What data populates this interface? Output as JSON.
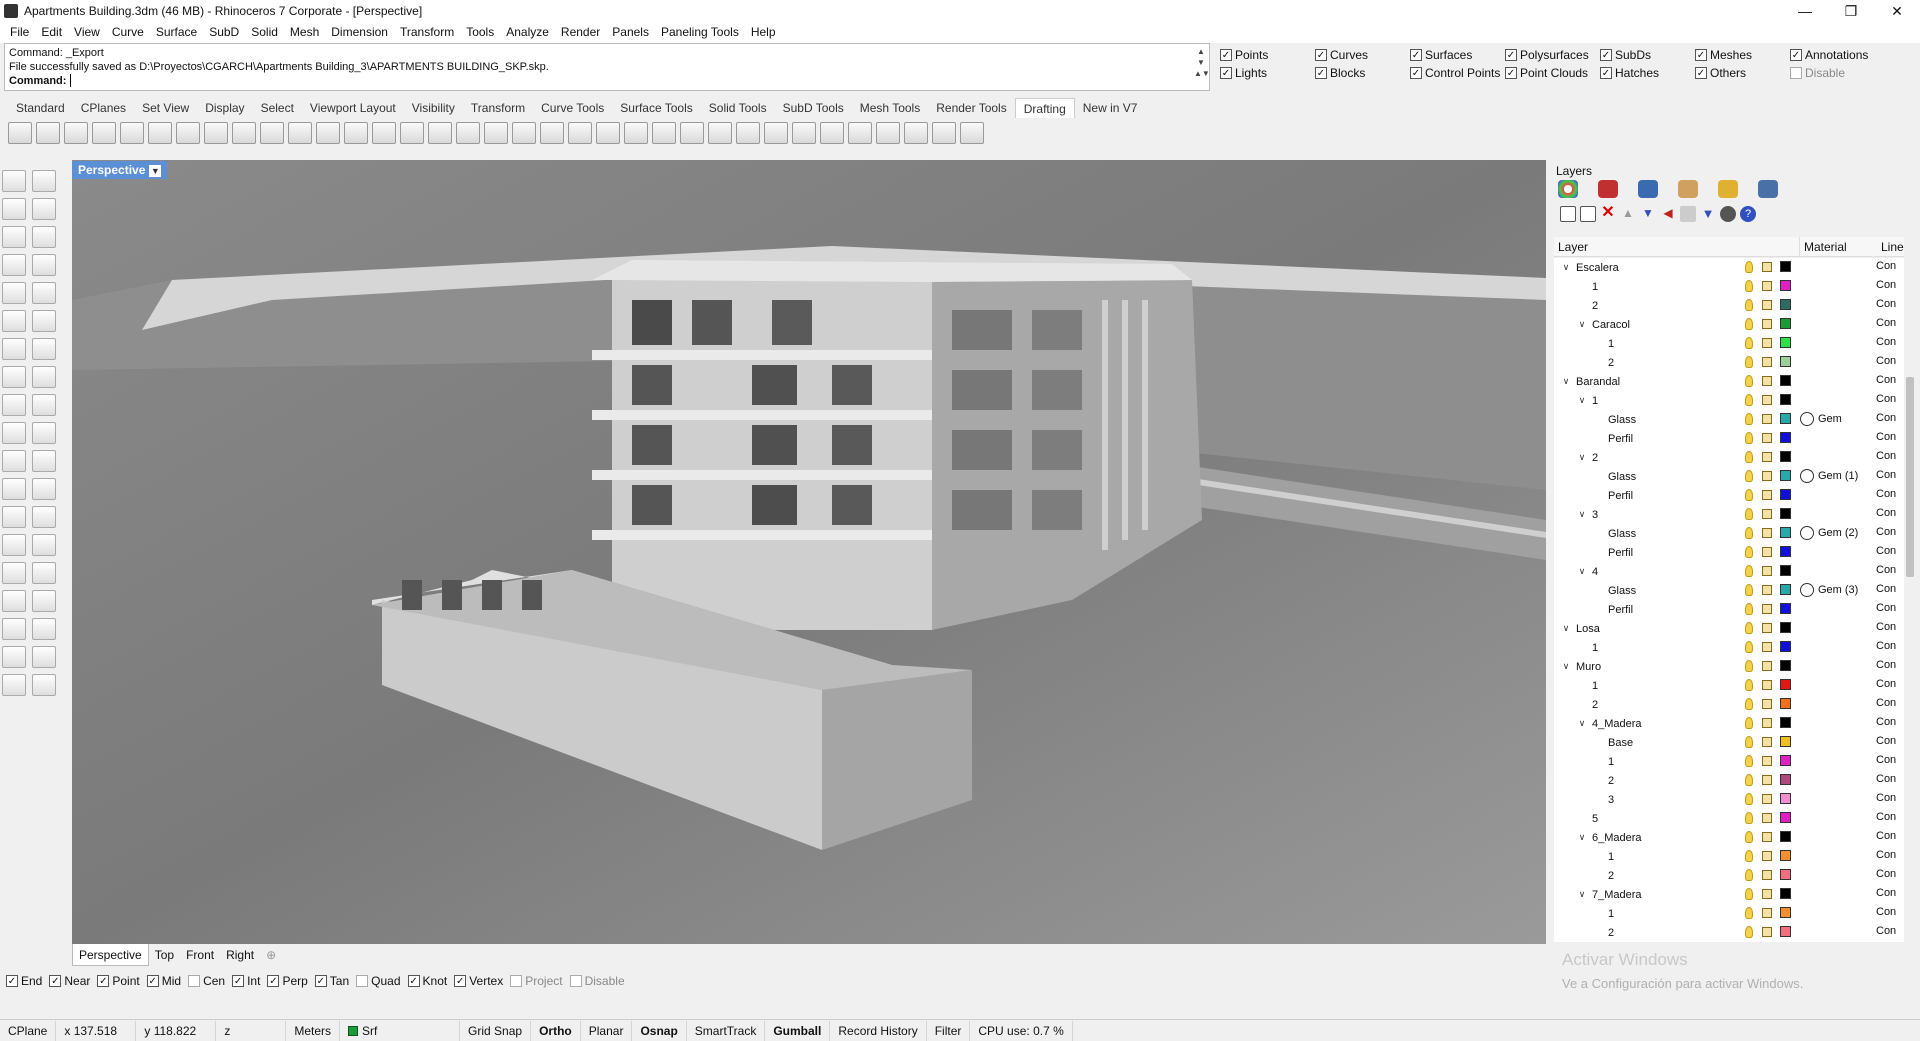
{
  "window": {
    "title": "Apartments Building.3dm (46 MB) - Rhinoceros 7 Corporate - [Perspective]"
  },
  "menu": [
    "File",
    "Edit",
    "View",
    "Curve",
    "Surface",
    "SubD",
    "Solid",
    "Mesh",
    "Dimension",
    "Transform",
    "Tools",
    "Analyze",
    "Render",
    "Panels",
    "Paneling Tools",
    "Help"
  ],
  "command": {
    "history": [
      "Command: _Export",
      "File successfully saved as D:\\Proyectos\\CGARCH\\Apartments Building_3\\APARTMENTS BUILDING_SKP.skp."
    ],
    "prompt": "Command:",
    "value": ""
  },
  "filters": [
    {
      "label": "Points",
      "checked": true
    },
    {
      "label": "Curves",
      "checked": true
    },
    {
      "label": "Surfaces",
      "checked": true
    },
    {
      "label": "Polysurfaces",
      "checked": true
    },
    {
      "label": "SubDs",
      "checked": true
    },
    {
      "label": "Meshes",
      "checked": true
    },
    {
      "label": "Annotations",
      "checked": true
    },
    {
      "label": "Lights",
      "checked": true
    },
    {
      "label": "Blocks",
      "checked": true
    },
    {
      "label": "Control Points",
      "checked": true
    },
    {
      "label": "Point Clouds",
      "checked": true
    },
    {
      "label": "Hatches",
      "checked": true
    },
    {
      "label": "Others",
      "checked": true
    },
    {
      "label": "Disable",
      "checked": false
    }
  ],
  "toolbar_tabs": [
    "Standard",
    "CPlanes",
    "Set View",
    "Display",
    "Select",
    "Viewport Layout",
    "Visibility",
    "Transform",
    "Curve Tools",
    "Surface Tools",
    "Solid Tools",
    "SubD Tools",
    "Mesh Tools",
    "Render Tools",
    "Drafting",
    "New in V7"
  ],
  "toolbar_active_tab": "Drafting",
  "viewport": {
    "label": "Perspective"
  },
  "viewport_tabs": [
    "Perspective",
    "Top",
    "Front",
    "Right"
  ],
  "osnaps": [
    {
      "label": "End",
      "checked": true
    },
    {
      "label": "Near",
      "checked": true
    },
    {
      "label": "Point",
      "checked": true
    },
    {
      "label": "Mid",
      "checked": true
    },
    {
      "label": "Cen",
      "checked": false
    },
    {
      "label": "Int",
      "checked": true
    },
    {
      "label": "Perp",
      "checked": true
    },
    {
      "label": "Tan",
      "checked": true
    },
    {
      "label": "Quad",
      "checked": false
    },
    {
      "label": "Knot",
      "checked": true
    },
    {
      "label": "Vertex",
      "checked": true
    },
    {
      "label": "Project",
      "checked": false
    },
    {
      "label": "Disable",
      "checked": false
    }
  ],
  "layers_panel": {
    "title": "Layers",
    "columns": {
      "layer": "Layer",
      "material": "Material",
      "linetype": "Line"
    },
    "rows": [
      {
        "name": "Escalera",
        "depth": 0,
        "exp": "open",
        "color": "#000000",
        "mat": "",
        "lt": "Con"
      },
      {
        "name": "1",
        "depth": 1,
        "exp": "",
        "color": "#e020c0",
        "mat": "",
        "lt": "Con"
      },
      {
        "name": "2",
        "depth": 1,
        "exp": "",
        "color": "#2e6b62",
        "mat": "",
        "lt": "Con"
      },
      {
        "name": "Caracol",
        "depth": 1,
        "exp": "open",
        "color": "#1c9a35",
        "mat": "",
        "lt": "Con"
      },
      {
        "name": "1",
        "depth": 2,
        "exp": "",
        "color": "#2fe04a",
        "mat": "",
        "lt": "Con"
      },
      {
        "name": "2",
        "depth": 2,
        "exp": "",
        "color": "#9ccf9c",
        "mat": "",
        "lt": "Con"
      },
      {
        "name": "Barandal",
        "depth": 0,
        "exp": "open",
        "color": "#000000",
        "mat": "",
        "lt": "Con"
      },
      {
        "name": "1",
        "depth": 1,
        "exp": "open",
        "color": "#000000",
        "mat": "",
        "lt": "Con"
      },
      {
        "name": "Glass",
        "depth": 2,
        "exp": "",
        "color": "#2aa8a8",
        "mat": "Gem",
        "lt": "Con"
      },
      {
        "name": "Perfil",
        "depth": 2,
        "exp": "",
        "color": "#1010d8",
        "mat": "",
        "lt": "Con"
      },
      {
        "name": "2",
        "depth": 1,
        "exp": "open",
        "color": "#000000",
        "mat": "",
        "lt": "Con"
      },
      {
        "name": "Glass",
        "depth": 2,
        "exp": "",
        "color": "#2aa8a8",
        "mat": "Gem (1)",
        "lt": "Con"
      },
      {
        "name": "Perfil",
        "depth": 2,
        "exp": "",
        "color": "#1010d8",
        "mat": "",
        "lt": "Con"
      },
      {
        "name": "3",
        "depth": 1,
        "exp": "open",
        "color": "#000000",
        "mat": "",
        "lt": "Con"
      },
      {
        "name": "Glass",
        "depth": 2,
        "exp": "",
        "color": "#2aa8a8",
        "mat": "Gem (2)",
        "lt": "Con"
      },
      {
        "name": "Perfil",
        "depth": 2,
        "exp": "",
        "color": "#1010d8",
        "mat": "",
        "lt": "Con"
      },
      {
        "name": "4",
        "depth": 1,
        "exp": "open",
        "color": "#000000",
        "mat": "",
        "lt": "Con"
      },
      {
        "name": "Glass",
        "depth": 2,
        "exp": "",
        "color": "#2aa8a8",
        "mat": "Gem (3)",
        "lt": "Con"
      },
      {
        "name": "Perfil",
        "depth": 2,
        "exp": "",
        "color": "#1010d8",
        "mat": "",
        "lt": "Con"
      },
      {
        "name": "Losa",
        "depth": 0,
        "exp": "open",
        "color": "#000000",
        "mat": "",
        "lt": "Con"
      },
      {
        "name": "1",
        "depth": 1,
        "exp": "",
        "color": "#1010d8",
        "mat": "",
        "lt": "Con"
      },
      {
        "name": "Muro",
        "depth": 0,
        "exp": "open",
        "color": "#000000",
        "mat": "",
        "lt": "Con"
      },
      {
        "name": "1",
        "depth": 1,
        "exp": "",
        "color": "#e01818",
        "mat": "",
        "lt": "Con"
      },
      {
        "name": "2",
        "depth": 1,
        "exp": "",
        "color": "#f07020",
        "mat": "",
        "lt": "Con"
      },
      {
        "name": "4_Madera",
        "depth": 1,
        "exp": "open",
        "color": "#000000",
        "mat": "",
        "lt": "Con"
      },
      {
        "name": "Base",
        "depth": 2,
        "exp": "",
        "color": "#f0c020",
        "mat": "",
        "lt": "Con"
      },
      {
        "name": "1",
        "depth": 2,
        "exp": "",
        "color": "#e020c0",
        "mat": "",
        "lt": "Con"
      },
      {
        "name": "2",
        "depth": 2,
        "exp": "",
        "color": "#b04880",
        "mat": "",
        "lt": "Con"
      },
      {
        "name": "3",
        "depth": 2,
        "exp": "",
        "color": "#f090d0",
        "mat": "",
        "lt": "Con"
      },
      {
        "name": "5",
        "depth": 1,
        "exp": "",
        "color": "#e020c0",
        "mat": "",
        "lt": "Con"
      },
      {
        "name": "6_Madera",
        "depth": 1,
        "exp": "open",
        "color": "#000000",
        "mat": "",
        "lt": "Con"
      },
      {
        "name": "1",
        "depth": 2,
        "exp": "",
        "color": "#f09030",
        "mat": "",
        "lt": "Con"
      },
      {
        "name": "2",
        "depth": 2,
        "exp": "",
        "color": "#f07080",
        "mat": "",
        "lt": "Con"
      },
      {
        "name": "7_Madera",
        "depth": 1,
        "exp": "open",
        "color": "#000000",
        "mat": "",
        "lt": "Con"
      },
      {
        "name": "1",
        "depth": 2,
        "exp": "",
        "color": "#f09030",
        "mat": "",
        "lt": "Con"
      },
      {
        "name": "2",
        "depth": 2,
        "exp": "",
        "color": "#f07080",
        "mat": "",
        "lt": "Con"
      }
    ]
  },
  "watermark": {
    "line1": "Activar Windows",
    "line2": "Ve a Configuración para activar Windows."
  },
  "status": {
    "cplane": "CPlane",
    "x": "x 137.518",
    "y": "y 118.822",
    "z": "z",
    "units": "Meters",
    "layer": "Srf",
    "grid_snap": "Grid Snap",
    "ortho": "Ortho",
    "planar": "Planar",
    "osnap": "Osnap",
    "smarttrack": "SmartTrack",
    "gumball": "Gumball",
    "record_history": "Record History",
    "filter": "Filter",
    "cpu": "CPU use: 0.7 %"
  }
}
